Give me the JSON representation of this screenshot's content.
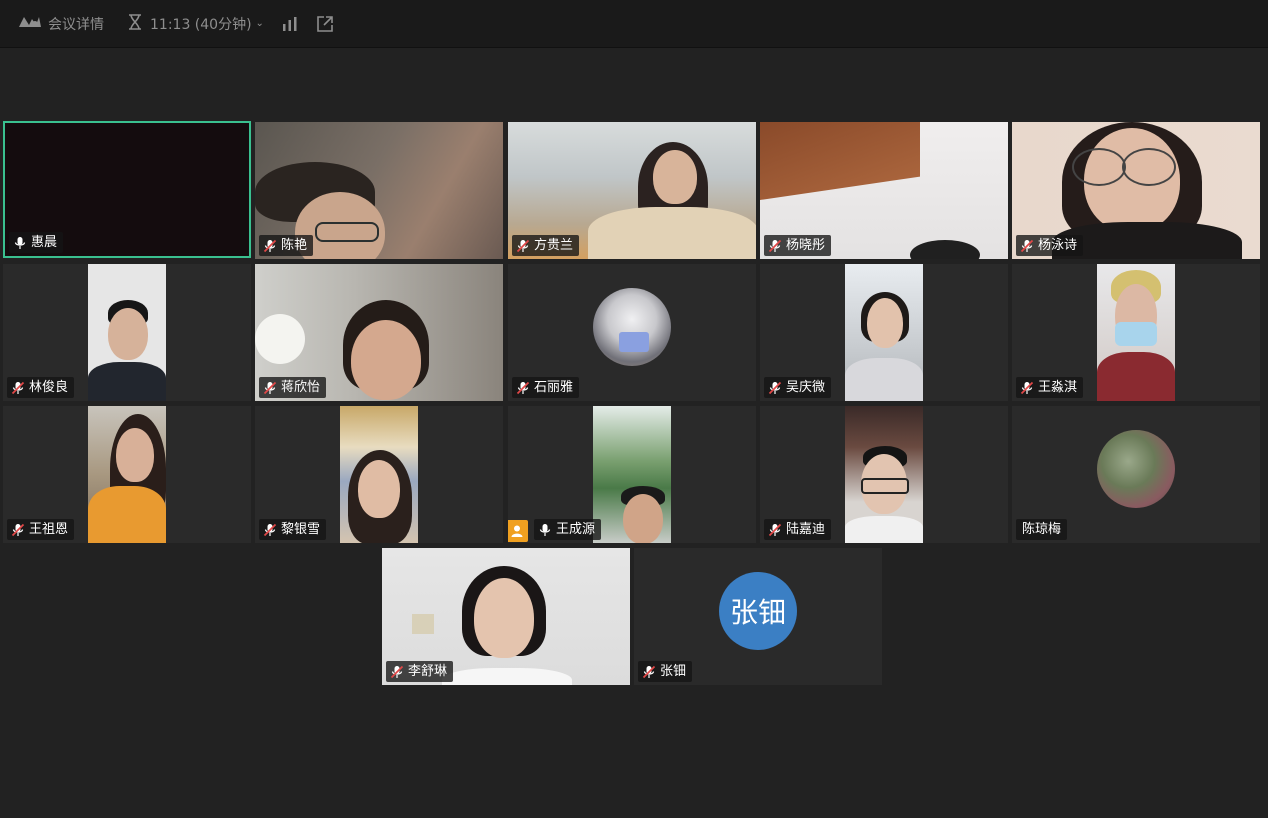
{
  "topbar": {
    "meeting_details": "会议详情",
    "timer_text": "11:13 (40分钟)"
  },
  "participants": [
    {
      "name": "惠晨",
      "mic": "on",
      "active": true
    },
    {
      "name": "陈艳",
      "mic": "muted"
    },
    {
      "name": "方贵兰",
      "mic": "muted"
    },
    {
      "name": "杨晓彤",
      "mic": "muted"
    },
    {
      "name": "杨泳诗",
      "mic": "muted"
    },
    {
      "name": "林俊良",
      "mic": "muted"
    },
    {
      "name": "蒋欣怡",
      "mic": "muted"
    },
    {
      "name": "石丽雅",
      "mic": "muted"
    },
    {
      "name": "吴庆微",
      "mic": "muted"
    },
    {
      "name": "王淼淇",
      "mic": "muted"
    },
    {
      "name": "王祖恩",
      "mic": "muted"
    },
    {
      "name": "黎银雪",
      "mic": "muted"
    },
    {
      "name": "王成源",
      "mic": "on",
      "host": true
    },
    {
      "name": "陆嘉迪",
      "mic": "muted"
    },
    {
      "name": "陈琼梅",
      "mic": "none"
    },
    {
      "name": "李舒琳",
      "mic": "muted"
    },
    {
      "name": "张钿",
      "mic": "muted",
      "avatar_initials": "张钿"
    }
  ],
  "colors": {
    "active_border": "#3ac08f",
    "avatar_blue": "#3b7fc4",
    "host_badge": "#f0a020",
    "muted_red": "#e24848"
  },
  "icons": {
    "logo": "tencent-meeting-logo-icon",
    "timer": "hourglass-icon",
    "stats": "signal-bars-icon",
    "share": "share-out-icon",
    "mic_on": "mic-icon",
    "mic_muted": "mic-muted-icon",
    "host": "host-person-icon"
  }
}
